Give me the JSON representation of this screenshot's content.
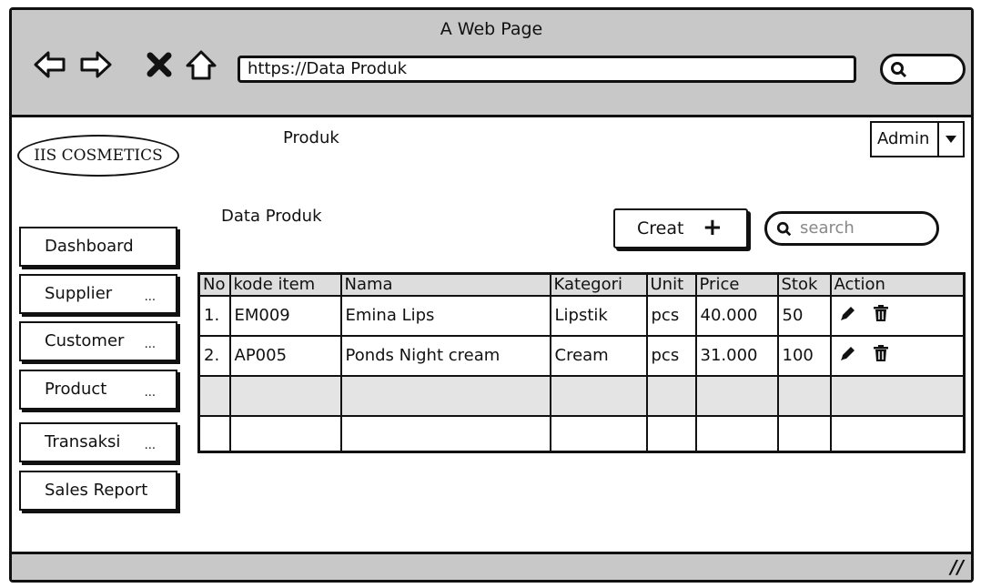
{
  "window": {
    "title": "A Web Page",
    "url": "https://Data Produk",
    "resize_glyph": "//"
  },
  "nav_icons": [
    "back-arrow-icon",
    "forward-arrow-icon",
    "close-x-icon",
    "home-icon"
  ],
  "brand": {
    "logo": "IIS COSMETICS"
  },
  "page": {
    "heading": "Produk",
    "subheading": "Data Produk"
  },
  "user_menu": {
    "label": "Admin"
  },
  "toolbar": {
    "create_label": "Creat",
    "create_icon": "+",
    "search_placeholder": "search"
  },
  "sidebar": {
    "items": [
      {
        "label": "Dashboard",
        "dots": ""
      },
      {
        "label": "Supplier",
        "dots": "..."
      },
      {
        "label": "Customer",
        "dots": "..."
      },
      {
        "label": "Product",
        "dots": "..."
      },
      {
        "label": "Transaksi",
        "dots": "..."
      },
      {
        "label": "Sales Report",
        "dots": ""
      }
    ]
  },
  "table": {
    "columns": [
      "No",
      "kode item",
      "Nama",
      "Kategori",
      "Unit",
      "Price",
      "Stok",
      "Action"
    ],
    "rows": [
      {
        "no": "1.",
        "kode": "EM009",
        "nama": "Emina Lips",
        "kategori": "Lipstik",
        "unit": "pcs",
        "price": "40.000",
        "stok": "50"
      },
      {
        "no": "2.",
        "kode": "AP005",
        "nama": "Ponds Night cream",
        "kategori": "Cream",
        "unit": "pcs",
        "price": "31.000",
        "stok": "100"
      }
    ]
  }
}
